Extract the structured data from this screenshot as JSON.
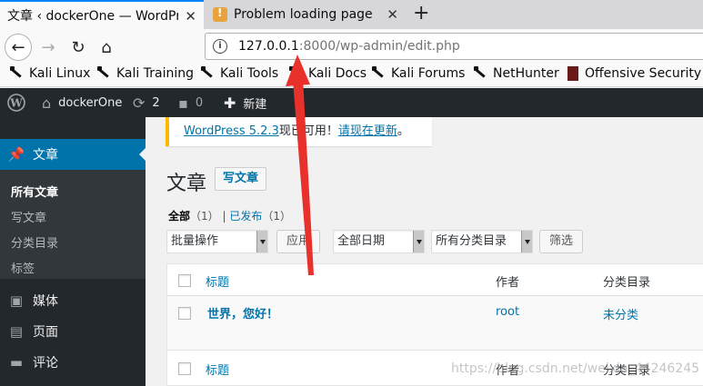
{
  "browser": {
    "tabs": [
      {
        "label": "文章 ‹ dockerOne — WordPr"
      },
      {
        "label": "Problem loading page"
      }
    ],
    "url_host": "127.0.0.1",
    "url_rest": ":8000/wp-admin/edit.php",
    "bookmarks": [
      "Kali Linux",
      "Kali Training",
      "Kali Tools",
      "Kali Docs",
      "Kali Forums",
      "NetHunter",
      "Offensive Security"
    ]
  },
  "adminbar": {
    "site": "dockerOne",
    "updates": "2",
    "comments": "0",
    "new": "新建"
  },
  "sidebar": {
    "active": "文章",
    "submenu": [
      "所有文章",
      "写文章",
      "分类目录",
      "标签"
    ],
    "menu": [
      "媒体",
      "页面",
      "评论"
    ]
  },
  "notice": {
    "version_link": "WordPress 5.2.3",
    "middle": "现已可用！",
    "update_link": "请现在更新",
    "end": "。"
  },
  "main": {
    "title": "文章",
    "add_new": "写文章",
    "filters": {
      "all": "全部",
      "all_count": "（1）",
      "sep": "|",
      "published": "已发布",
      "published_count": "（1）"
    },
    "bulk_action": "批量操作",
    "apply": "应用",
    "date_filter": "全部日期",
    "category_filter": "所有分类目录",
    "filter_button": "筛选",
    "columns": {
      "title": "标题",
      "author": "作者",
      "category": "分类目录"
    },
    "rows": [
      {
        "title": "世界，您好！",
        "author": "root",
        "category": "未分类"
      }
    ]
  },
  "watermark": "https://blog.csdn.net/weixin_44246245",
  "colors": {
    "accent": "#0073aa",
    "adminbar": "#23282d",
    "arrow": "#e8312b"
  }
}
